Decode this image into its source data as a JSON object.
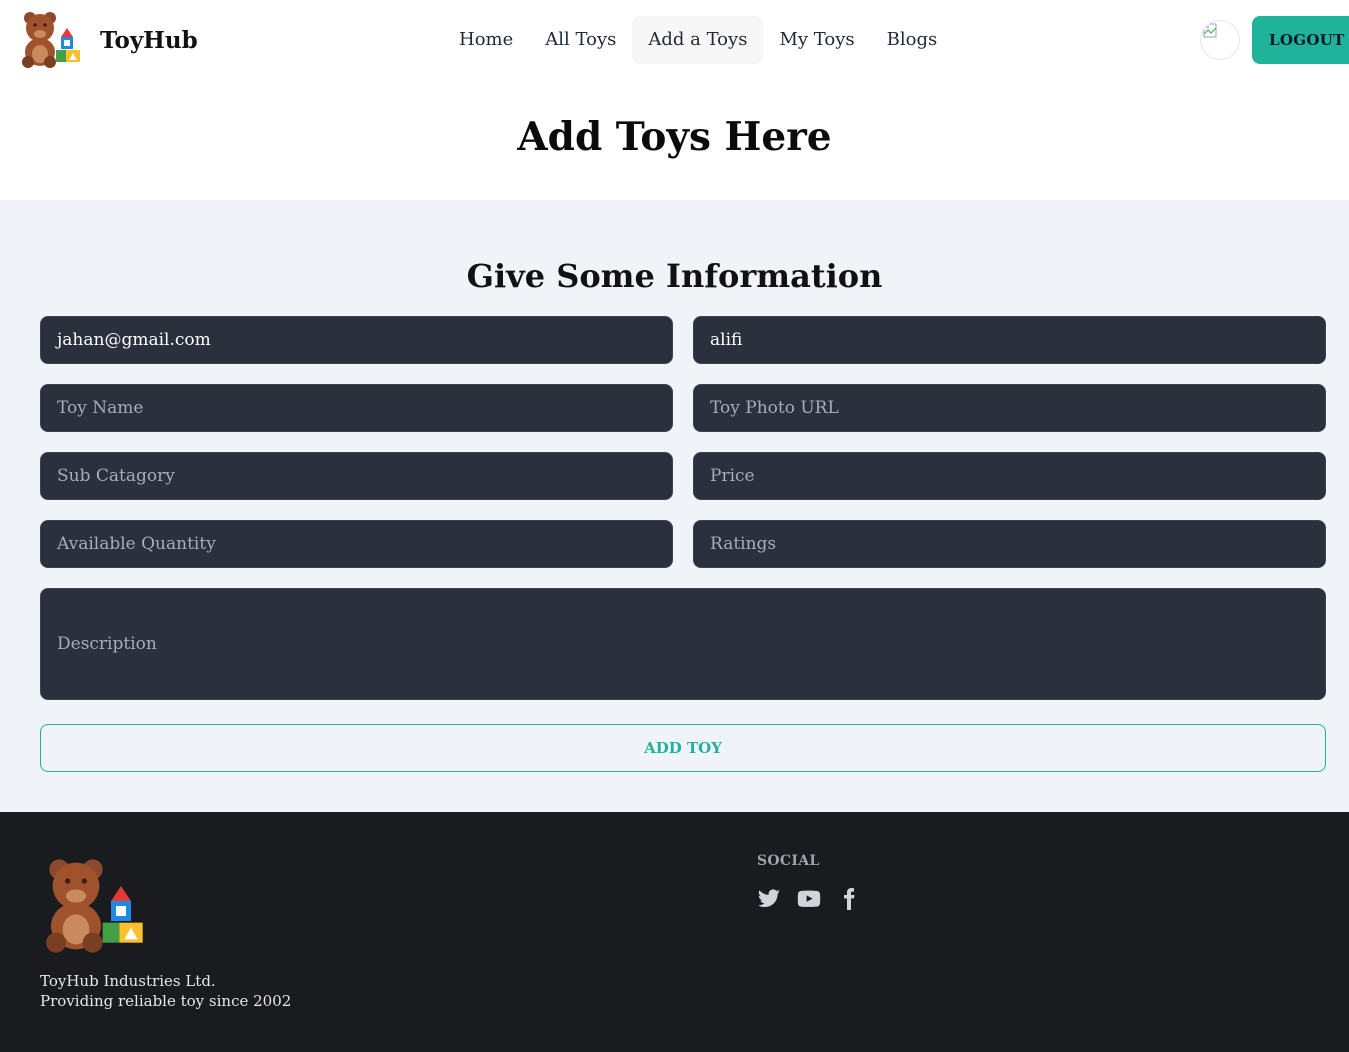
{
  "navbar": {
    "brand": "ToyHub",
    "menu": [
      {
        "label": "Home",
        "active": false
      },
      {
        "label": "All Toys",
        "active": false
      },
      {
        "label": "Add a Toys",
        "active": true
      },
      {
        "label": "My Toys",
        "active": false
      },
      {
        "label": "Blogs",
        "active": false
      }
    ],
    "logout_label": "LOGOUT",
    "avatar_icon": "broken-image-icon"
  },
  "page": {
    "title": "Add Toys Here"
  },
  "form": {
    "heading": "Give Some Information",
    "fields": [
      {
        "name": "seller-email",
        "value": "jahan@gmail.com",
        "placeholder": ""
      },
      {
        "name": "seller-name",
        "value": "alifi",
        "placeholder": ""
      },
      {
        "name": "toy-name",
        "value": "",
        "placeholder": "Toy Name"
      },
      {
        "name": "toy-photo-url",
        "value": "",
        "placeholder": "Toy Photo URL"
      },
      {
        "name": "sub-category",
        "value": "",
        "placeholder": "Sub Catagory"
      },
      {
        "name": "price",
        "value": "",
        "placeholder": "Price"
      },
      {
        "name": "available-quantity",
        "value": "",
        "placeholder": "Available Quantity"
      },
      {
        "name": "ratings",
        "value": "",
        "placeholder": "Ratings"
      }
    ],
    "description_placeholder": "Description",
    "submit_label": "ADD TOY"
  },
  "footer": {
    "company_line1": "ToyHub Industries Ltd.",
    "company_line2": "Providing reliable toy since 2002",
    "social_title": "SOCIAL",
    "social_icons": [
      "twitter-icon",
      "youtube-icon",
      "facebook-icon"
    ]
  },
  "colors": {
    "accent": "#1eb39a",
    "input_bg": "#2a303c",
    "section_bg": "#f0f4f9",
    "footer_bg": "#1a1b1e"
  }
}
